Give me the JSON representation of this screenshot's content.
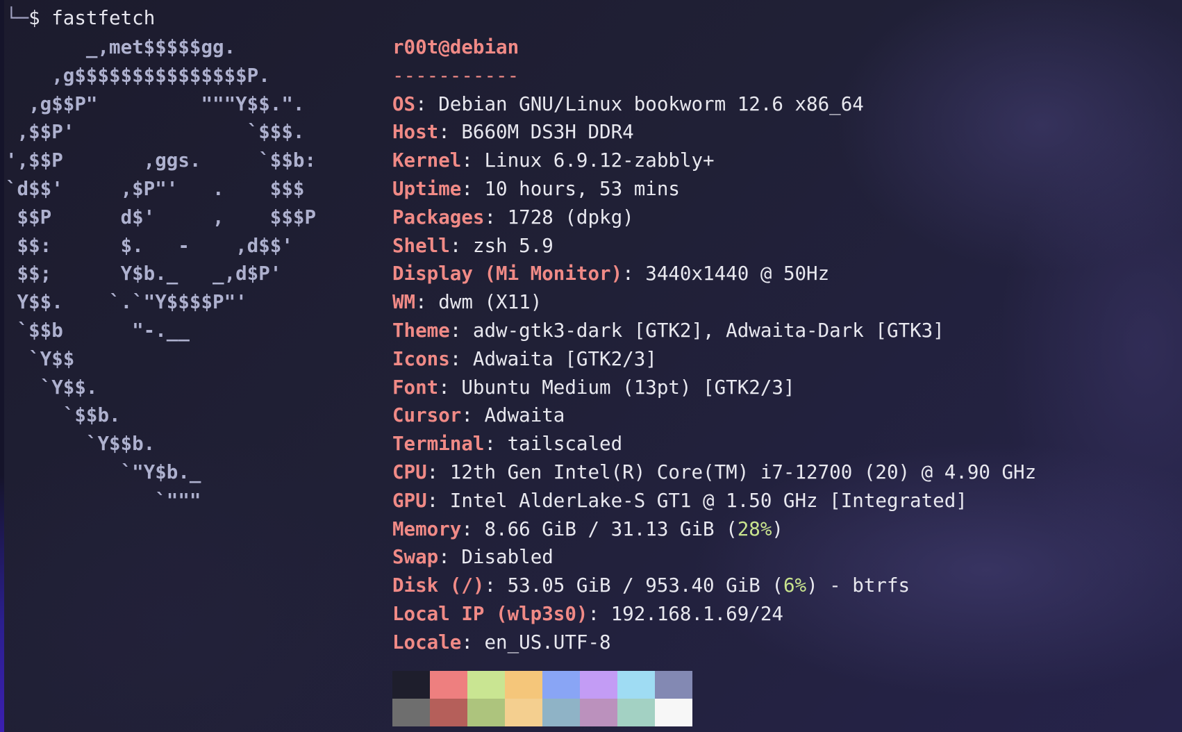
{
  "prompt": {
    "corner": "└─",
    "symbol": "$",
    "command": "fastfetch"
  },
  "ascii_logo": [
    "       _,met$$$$$gg.",
    "    ,g$$$$$$$$$$$$$$$P.",
    "  ,g$$P\"         \"\"\"Y$$.\".",
    " ,$$P'               `$$$.",
    "',$$P       ,ggs.     `$$b:",
    "`d$$'     ,$P\"'   .    $$$",
    " $$P      d$'     ,    $$$P",
    " $$:      $.   -    ,d$$'",
    " $$;      Y$b._   _,d$P'",
    " Y$$.    `.`\"Y$$$$P\"'",
    " `$$b      \"-.__",
    "  `Y$$",
    "   `Y$$.",
    "     `$$b.",
    "       `Y$$b.",
    "          `\"Y$b._",
    "             `\"\"\""
  ],
  "header": {
    "user_host": "r00t@debian",
    "separator": "-----------"
  },
  "info": [
    {
      "key": "OS",
      "value": "Debian GNU/Linux bookworm 12.6 x86_64"
    },
    {
      "key": "Host",
      "value": "B660M DS3H DDR4"
    },
    {
      "key": "Kernel",
      "value": "Linux 6.9.12-zabbly+"
    },
    {
      "key": "Uptime",
      "value": "10 hours, 53 mins"
    },
    {
      "key": "Packages",
      "value": "1728 (dpkg)"
    },
    {
      "key": "Shell",
      "value": "zsh 5.9"
    },
    {
      "key": "Display (Mi Monitor)",
      "value": "3440x1440 @ 50Hz"
    },
    {
      "key": "WM",
      "value": "dwm (X11)"
    },
    {
      "key": "Theme",
      "value": "adw-gtk3-dark [GTK2], Adwaita-Dark [GTK3]"
    },
    {
      "key": "Icons",
      "value": "Adwaita [GTK2/3]"
    },
    {
      "key": "Font",
      "value": "Ubuntu Medium (13pt) [GTK2/3]"
    },
    {
      "key": "Cursor",
      "value": "Adwaita"
    },
    {
      "key": "Terminal",
      "value": "tailscaled"
    },
    {
      "key": "CPU",
      "value": "12th Gen Intel(R) Core(TM) i7-12700 (20) @ 4.90 GHz"
    },
    {
      "key": "GPU",
      "value": "Intel AlderLake-S GT1 @ 1.50 GHz [Integrated]"
    },
    {
      "key": "Memory",
      "value_pre": "8.66 GiB / 31.13 GiB (",
      "value_pct": "28%",
      "value_post": ")"
    },
    {
      "key": "Swap",
      "value": "Disabled"
    },
    {
      "key": "Disk (/)",
      "value_pre": "53.05 GiB / 953.40 GiB (",
      "value_pct": "6%",
      "value_post": ") - btrfs"
    },
    {
      "key": "Local IP (wlp3s0)",
      "value": "192.168.1.69/24"
    },
    {
      "key": "Locale",
      "value": "en_US.UTF-8"
    }
  ],
  "palette": {
    "top": [
      "#1e1e2c",
      "#ee7f7f",
      "#c9e592",
      "#f5c67a",
      "#89a5f5",
      "#c39cf5",
      "#9fdcf3",
      "#8389b3"
    ],
    "bottom": [
      "#6e6e6e",
      "#b55f5a",
      "#adc47d",
      "#f4cf8f",
      "#8fb3c6",
      "#bb91bd",
      "#a3d1c3",
      "#f7f7f7"
    ]
  }
}
